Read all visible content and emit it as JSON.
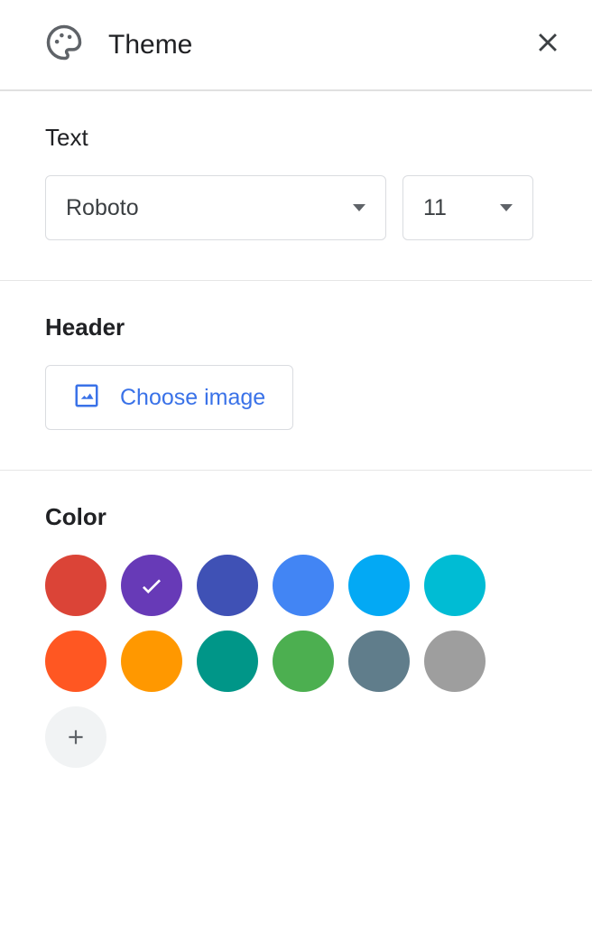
{
  "panel": {
    "title": "Theme"
  },
  "text_section": {
    "label": "Text",
    "font": "Roboto",
    "size": "11"
  },
  "header_section": {
    "label": "Header",
    "choose_image": "Choose image"
  },
  "color_section": {
    "label": "Color",
    "colors": [
      {
        "hex": "#db4437",
        "selected": false
      },
      {
        "hex": "#673ab7",
        "selected": true
      },
      {
        "hex": "#3f51b5",
        "selected": false
      },
      {
        "hex": "#4285f4",
        "selected": false
      },
      {
        "hex": "#03a9f4",
        "selected": false
      },
      {
        "hex": "#00bcd4",
        "selected": false
      },
      {
        "hex": "#ff5722",
        "selected": false
      },
      {
        "hex": "#ff9800",
        "selected": false
      },
      {
        "hex": "#009688",
        "selected": false
      },
      {
        "hex": "#4caf50",
        "selected": false
      },
      {
        "hex": "#607d8b",
        "selected": false
      },
      {
        "hex": "#9e9e9e",
        "selected": false
      }
    ]
  }
}
